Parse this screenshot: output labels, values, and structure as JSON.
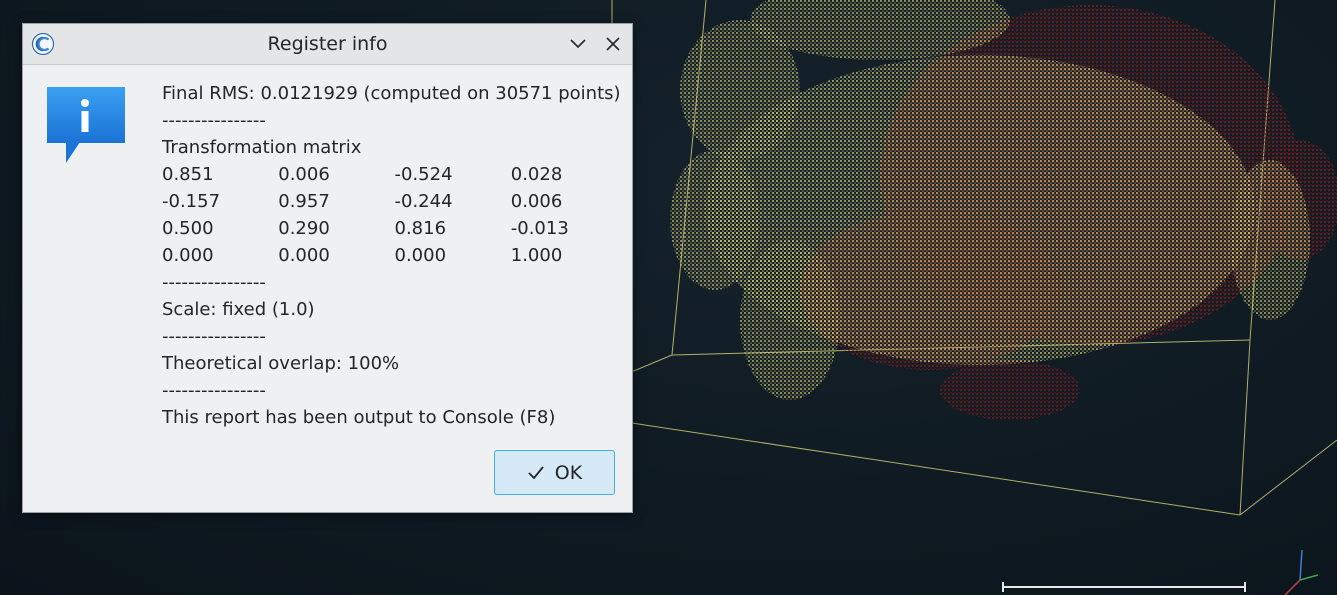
{
  "dialog": {
    "title": "Register info",
    "icons": {
      "app": "cloudcompare-logo-icon",
      "menu": "chevron-down-icon",
      "close": "close-icon",
      "message": "information-icon"
    },
    "rms_line": "Final RMS: 0.0121929 (computed on 30571 points)",
    "separator": "----------------",
    "matrix_title": "Transformation matrix",
    "matrix": [
      [
        "0.851",
        "0.006",
        "-0.524",
        "0.028"
      ],
      [
        "-0.157",
        "0.957",
        "-0.244",
        "0.006"
      ],
      [
        "0.500",
        "0.290",
        "0.816",
        "-0.013"
      ],
      [
        "0.000",
        "0.000",
        "0.000",
        "1.000"
      ]
    ],
    "scale_line": "Scale: fixed (1.0)",
    "overlap_line": "Theoretical overlap: 100%",
    "console_line": "This report has been output to Console (F8)",
    "ok_label": "OK"
  },
  "colors": {
    "accent": "#3daee9",
    "info_blue": "#1e88e5",
    "cloud_yellow": "#d8d27a",
    "cloud_red": "#8a1e1e",
    "background": "#0f1a22"
  }
}
